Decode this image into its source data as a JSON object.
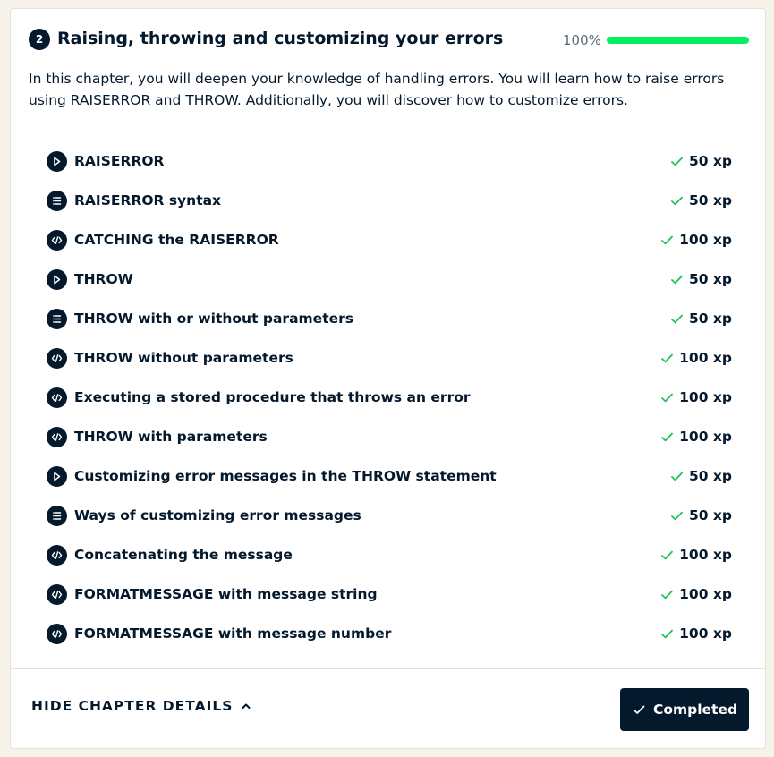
{
  "chapter": {
    "number": "2",
    "title": "Raising, throwing and customizing your errors",
    "progress_label": "100%",
    "progress_value": 1.0,
    "description": "In this chapter, you will deepen your knowledge of handling errors. You will learn how to raise errors using RAISERROR and THROW. Additionally, you will discover how to customize errors."
  },
  "exercises": [
    {
      "title": "RAISERROR",
      "type": "video",
      "icon": "play-icon",
      "xp": "50 xp",
      "completed": true
    },
    {
      "title": "RAISERROR syntax",
      "type": "multiple-choice",
      "icon": "list-icon",
      "xp": "50 xp",
      "completed": true
    },
    {
      "title": "CATCHING the RAISERROR",
      "type": "coding",
      "icon": "code-icon",
      "xp": "100 xp",
      "completed": true
    },
    {
      "title": "THROW",
      "type": "video",
      "icon": "play-icon",
      "xp": "50 xp",
      "completed": true
    },
    {
      "title": "THROW with or without parameters",
      "type": "multiple-choice",
      "icon": "list-icon",
      "xp": "50 xp",
      "completed": true
    },
    {
      "title": "THROW without parameters",
      "type": "coding",
      "icon": "code-icon",
      "xp": "100 xp",
      "completed": true
    },
    {
      "title": "Executing a stored procedure that throws an error",
      "type": "coding",
      "icon": "code-icon",
      "xp": "100 xp",
      "completed": true
    },
    {
      "title": "THROW with parameters",
      "type": "coding",
      "icon": "code-icon",
      "xp": "100 xp",
      "completed": true
    },
    {
      "title": "Customizing error messages in the THROW statement",
      "type": "video",
      "icon": "play-icon",
      "xp": "50 xp",
      "completed": true
    },
    {
      "title": "Ways of customizing error messages",
      "type": "multiple-choice",
      "icon": "list-icon",
      "xp": "50 xp",
      "completed": true
    },
    {
      "title": "Concatenating the message",
      "type": "coding",
      "icon": "code-icon",
      "xp": "100 xp",
      "completed": true
    },
    {
      "title": "FORMATMESSAGE with message string",
      "type": "coding",
      "icon": "code-icon",
      "xp": "100 xp",
      "completed": true
    },
    {
      "title": "FORMATMESSAGE with message number",
      "type": "coding",
      "icon": "code-icon",
      "xp": "100 xp",
      "completed": true
    }
  ],
  "footer": {
    "hide_details_label": "HIDE CHAPTER DETAILS",
    "completed_label": "Completed"
  },
  "colors": {
    "navy": "#05192d",
    "green": "#03ef62",
    "check_green": "#20c35a",
    "background": "#f7f3eb"
  }
}
